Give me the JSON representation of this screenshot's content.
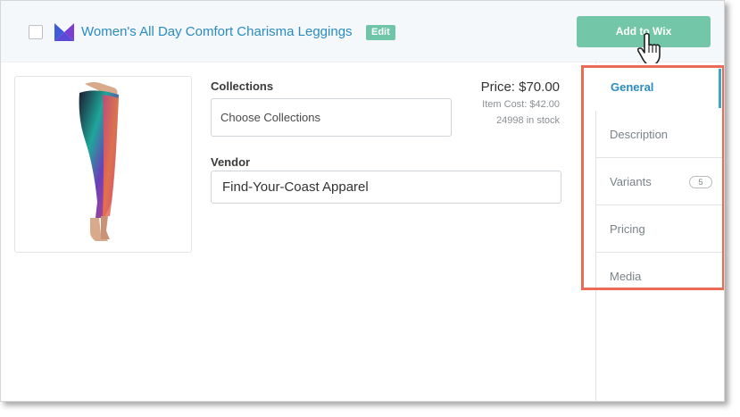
{
  "header": {
    "product_title": "Women's All Day Comfort Charisma Leggings",
    "edit_label": "Edit",
    "add_button_label": "Add to Wix"
  },
  "form": {
    "collections_label": "Collections",
    "collections_placeholder": "Choose Collections",
    "vendor_label": "Vendor",
    "vendor_value": "Find-Your-Coast Apparel"
  },
  "pricing": {
    "price": "Price: $70.00",
    "item_cost": "Item Cost: $42.00",
    "stock": "24998 in stock"
  },
  "tabs": [
    {
      "label": "General",
      "active": true
    },
    {
      "label": "Description"
    },
    {
      "label": "Variants",
      "badge": "5"
    },
    {
      "label": "Pricing"
    },
    {
      "label": "Media"
    }
  ],
  "colors": {
    "accent": "#2b8bbf",
    "button": "#74c6a9",
    "highlight": "#ea6c57"
  },
  "icons": [
    "checkbox",
    "brand-logo-icon",
    "hand-pointer-cursor-icon",
    "product-image"
  ]
}
